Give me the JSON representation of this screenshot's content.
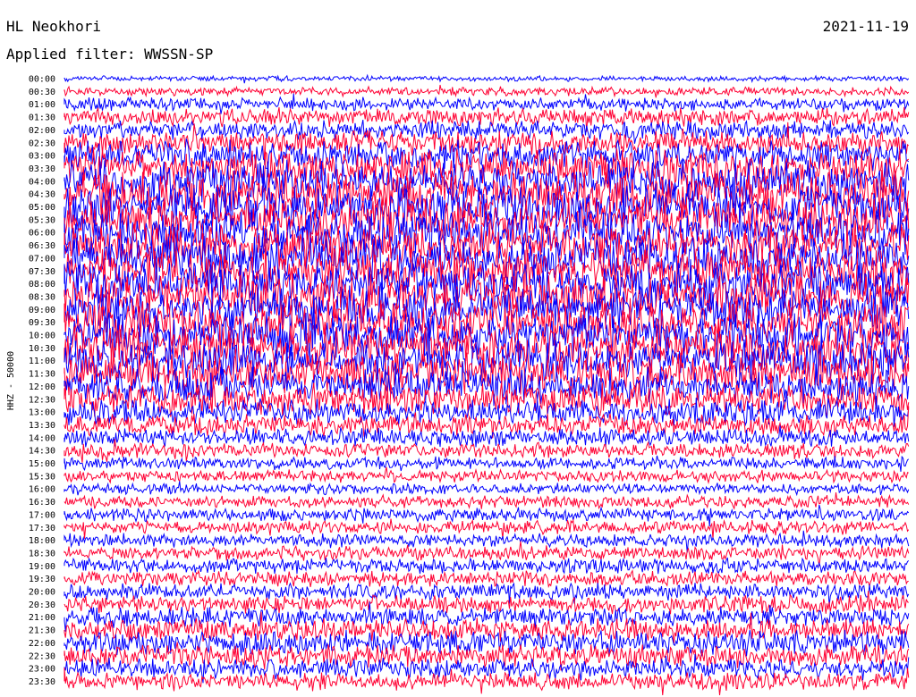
{
  "header": {
    "station": "HL Neokhori",
    "filter_label": "Applied filter:",
    "filter_value": "WWSSN-SP",
    "date": "2021-11-19"
  },
  "channel_label": "HHZ - 50000",
  "colors": {
    "blue": "#0000ff",
    "red": "#ff0033",
    "text": "#000000",
    "background": "#ffffff"
  },
  "chart_data": {
    "type": "line",
    "title": "",
    "xlabel": "",
    "ylabel": "HHZ - 50000",
    "series_colors_alternating": [
      "blue",
      "red"
    ],
    "rows": [
      {
        "time": "00:00",
        "color": "blue",
        "amplitude": 0.12
      },
      {
        "time": "00:30",
        "color": "red",
        "amplitude": 0.2
      },
      {
        "time": "01:00",
        "color": "blue",
        "amplitude": 0.3
      },
      {
        "time": "01:30",
        "color": "red",
        "amplitude": 0.4
      },
      {
        "time": "02:00",
        "color": "blue",
        "amplitude": 0.45
      },
      {
        "time": "02:30",
        "color": "red",
        "amplitude": 0.55
      },
      {
        "time": "03:00",
        "color": "blue",
        "amplitude": 0.7
      },
      {
        "time": "03:30",
        "color": "red",
        "amplitude": 0.85
      },
      {
        "time": "04:00",
        "color": "blue",
        "amplitude": 0.95
      },
      {
        "time": "04:30",
        "color": "red",
        "amplitude": 1.0
      },
      {
        "time": "05:00",
        "color": "blue",
        "amplitude": 1.0
      },
      {
        "time": "05:30",
        "color": "red",
        "amplitude": 1.0
      },
      {
        "time": "06:00",
        "color": "blue",
        "amplitude": 1.0
      },
      {
        "time": "06:30",
        "color": "red",
        "amplitude": 1.0
      },
      {
        "time": "07:00",
        "color": "blue",
        "amplitude": 1.0
      },
      {
        "time": "07:30",
        "color": "red",
        "amplitude": 1.0
      },
      {
        "time": "08:00",
        "color": "blue",
        "amplitude": 1.0
      },
      {
        "time": "08:30",
        "color": "red",
        "amplitude": 1.0
      },
      {
        "time": "09:00",
        "color": "blue",
        "amplitude": 1.0
      },
      {
        "time": "09:30",
        "color": "red",
        "amplitude": 1.0
      },
      {
        "time": "10:00",
        "color": "blue",
        "amplitude": 1.0
      },
      {
        "time": "10:30",
        "color": "red",
        "amplitude": 1.0
      },
      {
        "time": "11:00",
        "color": "blue",
        "amplitude": 0.95
      },
      {
        "time": "11:30",
        "color": "red",
        "amplitude": 0.9
      },
      {
        "time": "12:00",
        "color": "blue",
        "amplitude": 0.8
      },
      {
        "time": "12:30",
        "color": "red",
        "amplitude": 0.75
      },
      {
        "time": "13:00",
        "color": "blue",
        "amplitude": 0.6
      },
      {
        "time": "13:30",
        "color": "red",
        "amplitude": 0.5
      },
      {
        "time": "14:00",
        "color": "blue",
        "amplitude": 0.42
      },
      {
        "time": "14:30",
        "color": "red",
        "amplitude": 0.35
      },
      {
        "time": "15:00",
        "color": "blue",
        "amplitude": 0.3
      },
      {
        "time": "15:30",
        "color": "red",
        "amplitude": 0.28
      },
      {
        "time": "16:00",
        "color": "blue",
        "amplitude": 0.25
      },
      {
        "time": "16:30",
        "color": "red",
        "amplitude": 0.28
      },
      {
        "time": "17:00",
        "color": "blue",
        "amplitude": 0.3
      },
      {
        "time": "17:30",
        "color": "red",
        "amplitude": 0.3
      },
      {
        "time": "18:00",
        "color": "blue",
        "amplitude": 0.3
      },
      {
        "time": "18:30",
        "color": "red",
        "amplitude": 0.32
      },
      {
        "time": "19:00",
        "color": "blue",
        "amplitude": 0.35
      },
      {
        "time": "19:30",
        "color": "red",
        "amplitude": 0.35
      },
      {
        "time": "20:00",
        "color": "blue",
        "amplitude": 0.38
      },
      {
        "time": "20:30",
        "color": "red",
        "amplitude": 0.4
      },
      {
        "time": "21:00",
        "color": "blue",
        "amplitude": 0.45
      },
      {
        "time": "21:30",
        "color": "red",
        "amplitude": 0.5
      },
      {
        "time": "22:00",
        "color": "blue",
        "amplitude": 0.55
      },
      {
        "time": "22:30",
        "color": "red",
        "amplitude": 0.5
      },
      {
        "time": "23:00",
        "color": "blue",
        "amplitude": 0.45
      },
      {
        "time": "23:30",
        "color": "red",
        "amplitude": 0.4
      }
    ]
  }
}
